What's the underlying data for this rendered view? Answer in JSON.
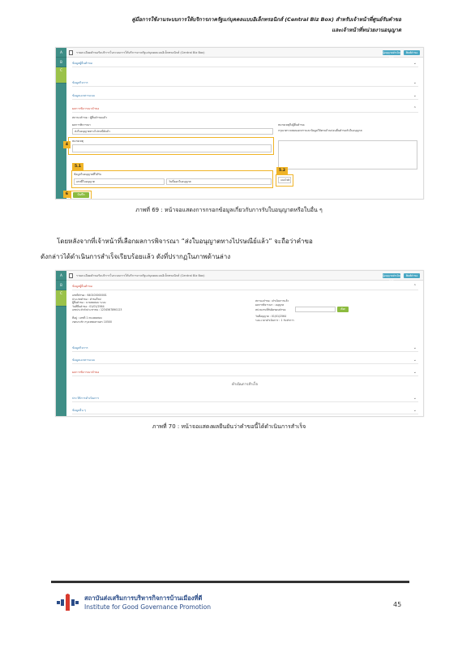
{
  "header": {
    "line1": "คู่มือการใช้งานระบบการให้บริการภาครัฐแก่บุคคลแบบอิเล็กทรอนิกส์ (Central Biz Box) สำหรับเจ้าหน้าที่ศูนย์รับคำขอ",
    "line2": "และเจ้าหน้าที่หน่วยงานอนุญาต"
  },
  "shot1": {
    "top_text": "รายละเอียดคำขอรับบริการในระบบการให้บริการภาครัฐแก่บุคคลแบบอิเล็กทรอนิกส์ (Central Biz Box)",
    "btn1": "ผู้อนุญาตดำเนินการ",
    "btn2": "พิมพ์คำขอ",
    "sections": [
      "ข้อมูลผู้ยื่นคำขอ",
      "ข้อมูลกิจการ",
      "ข้อมูลเอกสารแนบ",
      "ผลการพิจารณาคำขอ"
    ],
    "status_label": "สถานะคำขอ : ผู้ยื่นคำขอแล้ว",
    "result_label": "ผลการพิจารณา",
    "result_value": "ส่งใบอนุญาตทางไปรษณีย์แล้ว",
    "note_label": "หมายเหตุ",
    "right_label": "หมายเหตุถึงผู้ยื่นคำขอ",
    "right_text": "กรุณาตรวจสอบเอกสารและข้อมูลให้ครบถ้วนก่อนยื่นคำขอรับใบอนุญาต",
    "license_label": "ข้อมูลใบอนุญาตที่ได้รับ",
    "license_col1": "เลขที่ใบอนุญาต",
    "license_col2": "วันที่ออกใบอนุญาต",
    "attach_btn": "แนบไฟล์",
    "save_btn": "บันทึก",
    "badges": [
      "4",
      "5.1",
      "5.2",
      "6"
    ]
  },
  "caption1": "ภาพที่ 69 : หน้าจอแสดงการกรอกข้อมูลเกี่ยวกับการรับใบอนุญาตหรือใบอื่น ๆ",
  "paragraph": {
    "line1": "โดยหลังจากที่เจ้าหน้าที่เลือกผลการพิจารณา “ส่งใบอนุญาตทางไปรษณีย์แล้ว” จะถือว่าคำขอ",
    "line2": "ดังกล่าวได้ดำเนินการสำเร็จเรียบร้อยแล้ว ดังที่ปรากฏในภาพด้านล่าง"
  },
  "shot2": {
    "top_text": "รายละเอียดคำขอรับบริการในระบบการให้บริการภาครัฐแก่บุคคลแบบอิเล็กทรอนิกส์ (Central Biz Box)",
    "btn1": "ผู้อนุญาตดำเนินการ",
    "btn2": "พิมพ์คำขอ",
    "first_section": "ข้อมูลผู้ยื่นคำขอ",
    "info_left": [
      "เลขที่คำขอ : 640100000001",
      "ประเภทคำขอ : คำขอใหม่",
      "ผู้ยื่นคำขอ : นายทดสอบ ระบบ",
      "วันที่ยื่นคำขอ : 01/01/2564",
      "เลขประจำตัวประชาชน : 1234567890123"
    ],
    "info_left2": [
      "ที่อยู่ : เลขที่ 1 ถนนทดสอบ",
      "เขตบางรัก กรุงเทพมหานคร 10500"
    ],
    "info_right": [
      "สถานะคำขอ : ดำเนินการแล้ว",
      "ผลการพิจารณา : อนุญาต"
    ],
    "info_right_label": "หน่วยงานที่รับผิดชอบคำขอ",
    "select_btn": "เลือก",
    "info_right2": [
      "วันที่อนุญาต : 01/01/2564",
      "ระยะเวลาดำเนินการ : 1 วันทำการ"
    ],
    "sections": [
      "ข้อมูลกิจการ",
      "ข้อมูลเอกสารแนบ",
      "ผลการพิจารณาคำขอ"
    ],
    "success": "ดำเนินการสำเร็จ",
    "sections_after": [
      "ประวัติการดำเนินการ",
      "ข้อมูลอื่น ๆ"
    ]
  },
  "caption2": "ภาพที่ 70 : หน้าจอแสดงผลยืนยันว่าคำขอนี้ได้ดำเนินการสำเร็จ",
  "footer": {
    "org_th": "สถาบันส่งเสริมการบริหารกิจการบ้านเมืองที่ดี",
    "org_en": "Institute for Good Governance Promotion",
    "page": "45"
  }
}
